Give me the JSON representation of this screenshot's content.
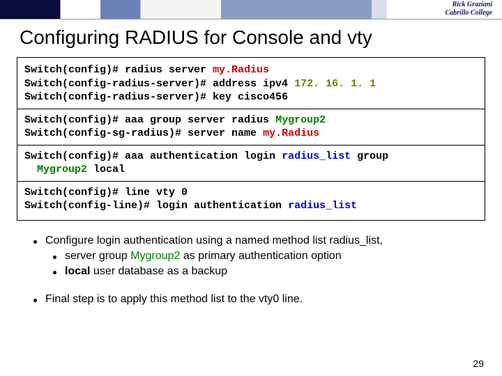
{
  "banner": {
    "name": "Rick Graziani",
    "school": "Cabrillo College"
  },
  "title": "Configuring RADIUS for Console and vty",
  "code": {
    "block1": {
      "l1a": "Switch(config)# radius server ",
      "l1b": "my.Radius",
      "l2a": "Switch(config-radius-server)# address ipv4 ",
      "l2b": "172. 16. 1. 1",
      "l3": "Switch(config-radius-server)# key cisco456"
    },
    "block2": {
      "l1a": "Switch(config)# aaa group server radius ",
      "l1b": "Mygroup2",
      "l2a": "Switch(config-sg-radius)# server name ",
      "l2b": "my.Radius"
    },
    "block3": {
      "l1a": "Switch(config)# aaa authentication login ",
      "l1b": "radius_list",
      "l1c": " group",
      "l2a": "Mygroup2",
      "l2b": " local"
    },
    "block4": {
      "l1": "Switch(config)# line vty 0",
      "l2a": "Switch(config-line)# login authentication ",
      "l2b": "radius_list"
    }
  },
  "bullets": {
    "b1": "Configure login authentication using a named method list radius_list,",
    "b1s1a": "server group ",
    "b1s1b": "Mygroup2",
    "b1s1c": " as primary authentication option",
    "b1s2a": "local",
    "b1s2b": " user database as a backup",
    "b2": "Final step is to apply this method list to the vty0 line."
  },
  "pageNumber": "29"
}
